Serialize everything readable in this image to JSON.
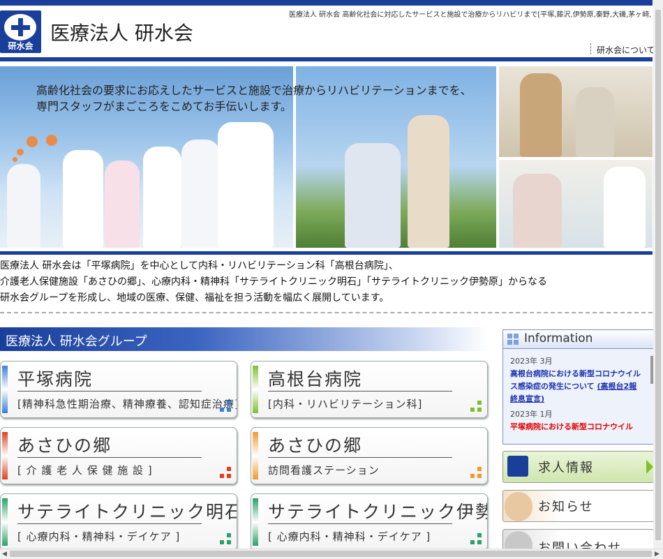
{
  "header": {
    "logo_text": "研水会",
    "org_name": "医療法人 研水会",
    "tagline": "医療法人 研水会 高齢化社会に対応したサービスと施設で治療からリハビリまで[平塚,藤沢,伊勢原,秦野,大磯,茅ヶ崎,二",
    "nav_about": "研水会について"
  },
  "hero": {
    "line1": "高齢化社会の要求にお応えしたサービスと施設で治療からリハビリテーションまでを、",
    "line2": "専門スタッフがまごころをこめてお手伝いします。"
  },
  "intro": {
    "line1": "医療法人 研水会は「平塚病院」を中心として内科・リハビリテーション科「高根台病院」、",
    "line2": "介護老人保健施設「あさひの郷」、心療内科・精神科「サテライトクリニック明石」「サテライトクリニック伊勢原」からなる",
    "line3": "研水会グループを形成し、地域の医療、保健、福祉を担う活動を幅広く展開しています。"
  },
  "group": {
    "heading": "医療法人 研水会グループ",
    "cards": [
      {
        "title": "平塚病院",
        "subtitle": "[精神科急性期治療、精神療養、認知症治療]",
        "color": "#3a7fd6"
      },
      {
        "title": "高根台病院",
        "subtitle": "[内科・リハビリテーション科]",
        "color": "#7fbf2e"
      },
      {
        "title": "あさひの郷",
        "subtitle": "[ 介 護 老 人 保 健 施 設 ]",
        "color": "#e04020"
      },
      {
        "title": "あさひの郷",
        "subtitle": "訪問看護ステーション",
        "color": "#f09a30"
      },
      {
        "title": "サテライトクリニック明石",
        "subtitle": "[ 心療内科・精神科・デイケア ]",
        "color": "#2aa06a"
      },
      {
        "title": "サテライトクリニック伊勢原",
        "subtitle": "[ 心療内科・精神科・デイケア ]",
        "color": "#2aa06a"
      }
    ]
  },
  "info": {
    "heading": "Information",
    "items": [
      {
        "date": "2023年 3月",
        "text": "高根台病院における新型コロナウイルス感染症の発生について",
        "link": "(高根台2報 終息宣言)"
      },
      {
        "date": "2023年 1月",
        "text": "平塚病院における新型コロナウイル"
      }
    ]
  },
  "side_buttons": {
    "jobs": "求人情報",
    "news": "お知らせ",
    "contact": "お問い合わせ"
  }
}
